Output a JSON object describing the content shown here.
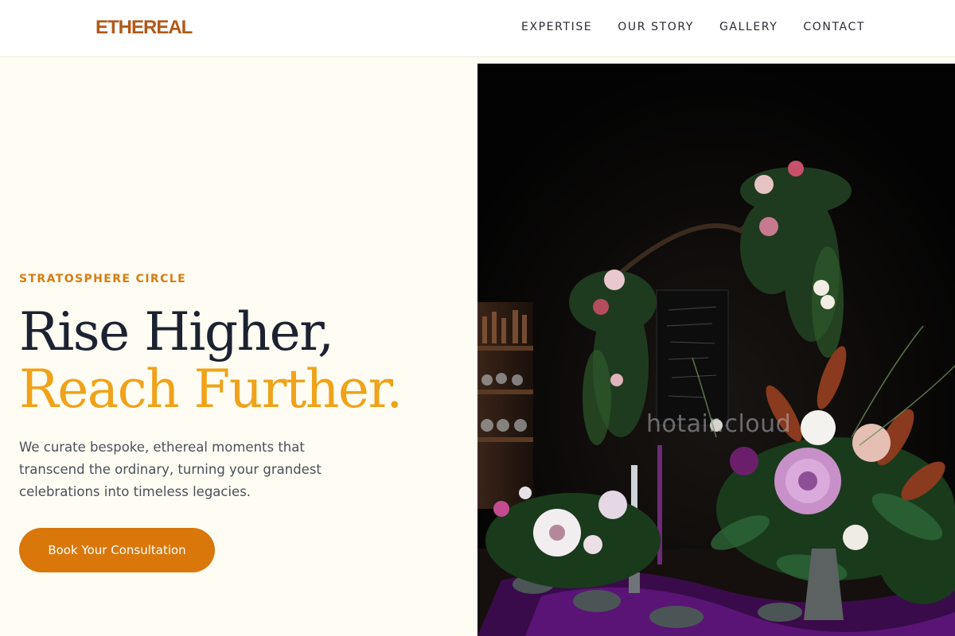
{
  "brand": {
    "logo": "ETHEREAL"
  },
  "nav": {
    "items": [
      {
        "label": "EXPERTISE"
      },
      {
        "label": "OUR STORY"
      },
      {
        "label": "GALLERY"
      },
      {
        "label": "CONTACT"
      }
    ]
  },
  "hero": {
    "eyebrow": "STRATOSPHERE CIRCLE",
    "headline_line1": "Rise Higher,",
    "headline_line2": "Reach Further.",
    "lead": "We curate bespoke, ethereal moments that transcend the ordinary, turning your grandest celebrations into timeless legacies.",
    "cta_label": "Book Your Consultation",
    "image": {
      "subject": "floral-arrangement-photo",
      "watermark": "hotair.cloud"
    }
  },
  "colors": {
    "brand": "#b1591b",
    "accent": "#f0a21a",
    "eyebrow": "#d97b12",
    "cta_bg": "#d9770b",
    "heading": "#1c2230",
    "page_bg": "#fffdf3"
  }
}
